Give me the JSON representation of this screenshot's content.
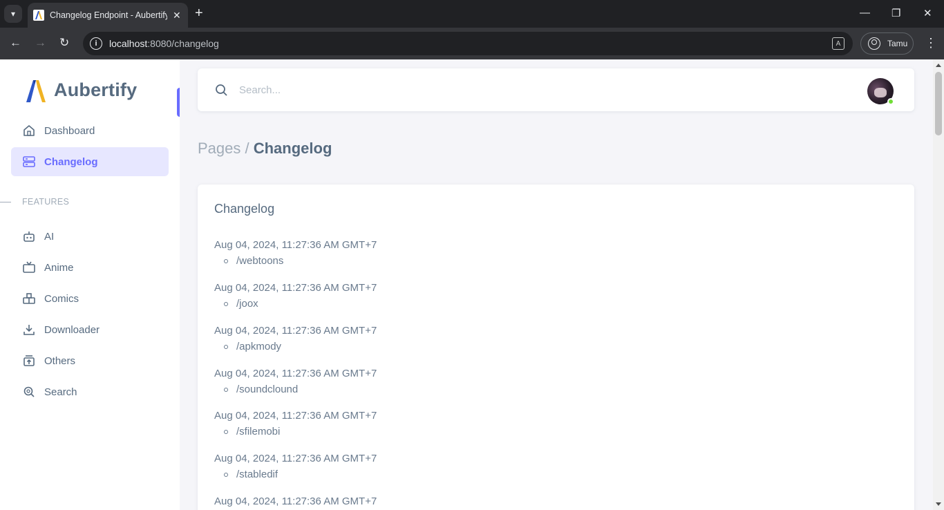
{
  "browser": {
    "tab_title": "Changelog Endpoint - Aubertify",
    "url_host": "localhost",
    "url_rest": ":8080/changelog",
    "profile_label": "Tamu"
  },
  "sidebar": {
    "brand": "Aubertify",
    "items": [
      {
        "label": "Dashboard",
        "icon": "home-icon"
      },
      {
        "label": "Changelog",
        "icon": "server-icon",
        "active": true
      }
    ],
    "section_header": "FEATURES",
    "features": [
      {
        "label": "AI",
        "icon": "bot-icon"
      },
      {
        "label": "Anime",
        "icon": "tv-icon"
      },
      {
        "label": "Comics",
        "icon": "book-icon"
      },
      {
        "label": "Downloader",
        "icon": "download-icon"
      },
      {
        "label": "Others",
        "icon": "box-icon"
      },
      {
        "label": "Search",
        "icon": "search-icon"
      }
    ]
  },
  "navbar": {
    "search_placeholder": "Search..."
  },
  "breadcrumb": {
    "parent": "Pages /",
    "current": "Changelog"
  },
  "card": {
    "title": "Changelog",
    "entries": [
      {
        "date": "Aug 04, 2024, 11:27:36 AM GMT+7",
        "path": "/webtoons"
      },
      {
        "date": "Aug 04, 2024, 11:27:36 AM GMT+7",
        "path": "/joox"
      },
      {
        "date": "Aug 04, 2024, 11:27:36 AM GMT+7",
        "path": "/apkmody"
      },
      {
        "date": "Aug 04, 2024, 11:27:36 AM GMT+7",
        "path": "/soundclound"
      },
      {
        "date": "Aug 04, 2024, 11:27:36 AM GMT+7",
        "path": "/sfilemobi"
      },
      {
        "date": "Aug 04, 2024, 11:27:36 AM GMT+7",
        "path": "/stabledif"
      },
      {
        "date": "Aug 04, 2024, 11:27:36 AM GMT+7",
        "path": ""
      }
    ]
  },
  "colors": {
    "accent": "#696cff",
    "accent_bg": "#e7e7ff",
    "text": "#566a7f",
    "status_online": "#71dd37"
  }
}
